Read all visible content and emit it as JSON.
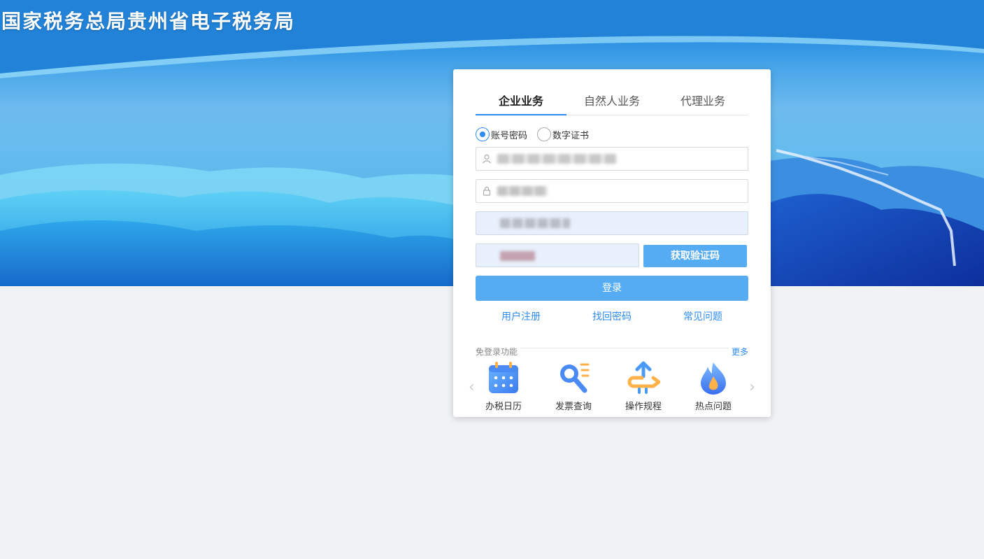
{
  "header": {
    "title": "国家税务总局贵州省电子税务局"
  },
  "login": {
    "tabs": [
      {
        "label": "企业业务",
        "active": true
      },
      {
        "label": "自然人业务",
        "active": false
      },
      {
        "label": "代理业务",
        "active": false
      }
    ],
    "login_modes": [
      {
        "label": "账号密码",
        "checked": true
      },
      {
        "label": "数字证书",
        "checked": false
      }
    ],
    "sms_button": "获取验证码",
    "submit_button": "登录",
    "links": [
      "用户注册",
      "找回密码",
      "常见问题"
    ]
  },
  "free_functions": {
    "title": "免登录功能",
    "more": "更多",
    "items": [
      {
        "label": "办税日历",
        "icon": "calendar-icon"
      },
      {
        "label": "发票查询",
        "icon": "invoice-search-icon"
      },
      {
        "label": "操作规程",
        "icon": "procedure-icon"
      },
      {
        "label": "热点问题",
        "icon": "flame-icon"
      }
    ]
  },
  "colors": {
    "primary": "#2e8cf0",
    "button": "#56acf2",
    "banner": "#2a8ae0"
  }
}
